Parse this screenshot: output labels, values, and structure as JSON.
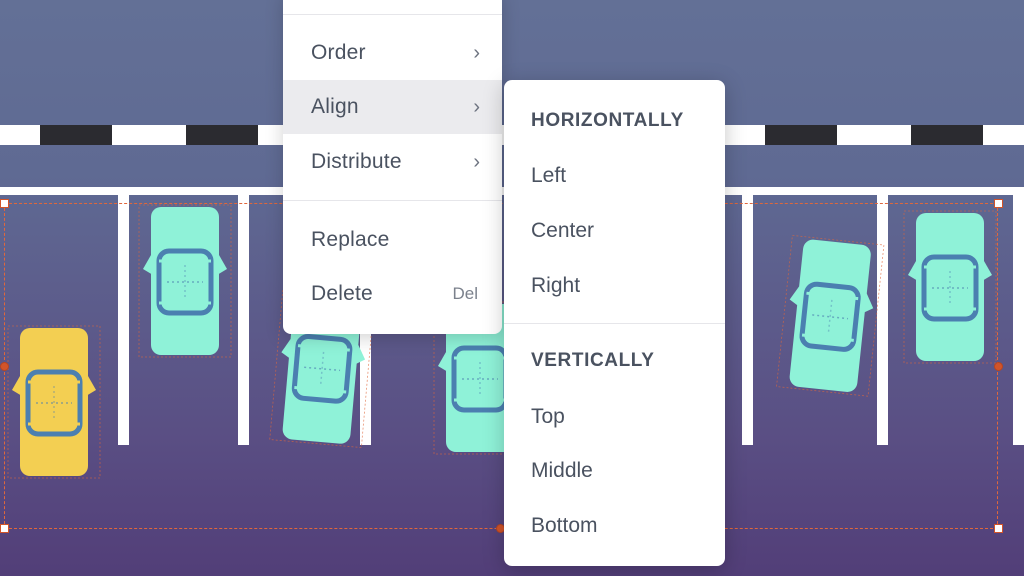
{
  "context_menu": {
    "items": [
      {
        "label": "Order",
        "has_submenu": true
      },
      {
        "label": "Align",
        "has_submenu": true,
        "active": true
      },
      {
        "label": "Distribute",
        "has_submenu": true
      },
      {
        "label": "Replace",
        "has_submenu": false
      },
      {
        "label": "Delete",
        "has_submenu": false,
        "shortcut": "Del"
      }
    ],
    "chevron_icon": "chevron-right-icon"
  },
  "align_submenu": {
    "horizontal_heading": "HORIZONTALLY",
    "horizontal_items": [
      "Left",
      "Center",
      "Right"
    ],
    "vertical_heading": "VERTICALLY",
    "vertical_items": [
      "Top",
      "Middle",
      "Bottom"
    ]
  },
  "canvas": {
    "colors": {
      "background_top": "#637096",
      "background_bottom": "#523e78",
      "road": "#ffffff",
      "road_dash": "#2b2b30",
      "car_teal": "#8ff2d8",
      "car_yellow": "#f3cf52",
      "car_window": "#4b7fb0",
      "selection": "#e0673b"
    },
    "cars": [
      {
        "name": "car-yellow",
        "color": "yellow"
      },
      {
        "name": "car-teal-1",
        "color": "teal"
      },
      {
        "name": "car-teal-2",
        "color": "teal"
      },
      {
        "name": "car-teal-3",
        "color": "teal"
      },
      {
        "name": "car-teal-4",
        "color": "teal"
      },
      {
        "name": "car-teal-5",
        "color": "teal"
      }
    ]
  }
}
